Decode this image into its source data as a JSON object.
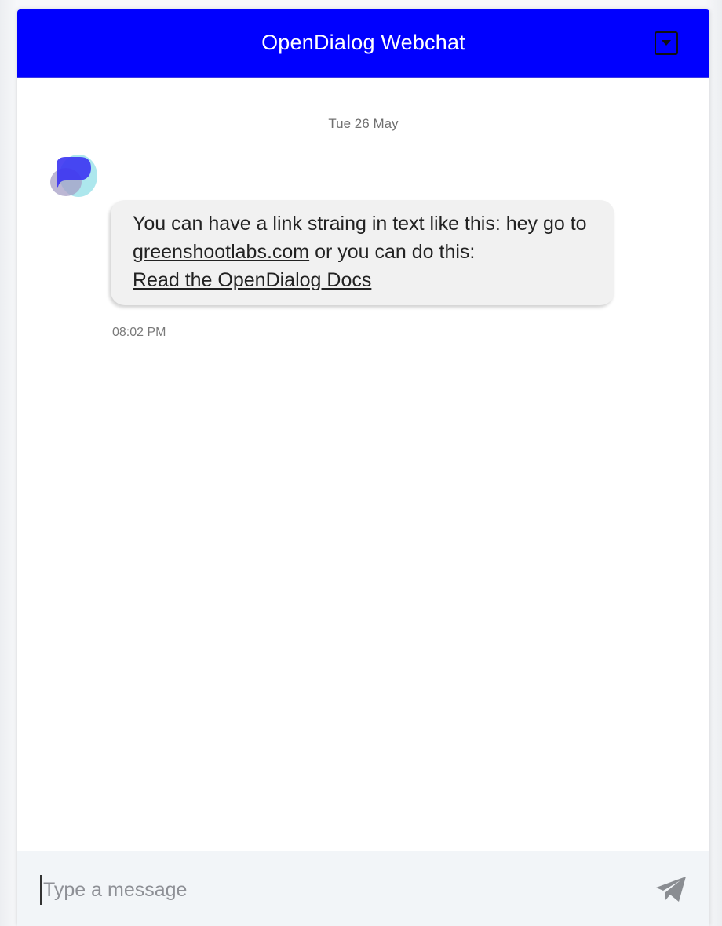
{
  "header": {
    "title": "OpenDialog Webchat",
    "toggle_icon": "caret-down-icon"
  },
  "conversation": {
    "date_separator": "Tue 26 May",
    "messages": [
      {
        "sender": "bot",
        "text_before_link": "You can have a link straing in text like this: hey go to ",
        "inline_link_text": "greenshootlabs.com",
        "text_after_link": " or you can do this: ",
        "button_link_text": "Read the OpenDialog Docs",
        "time": "08:02 PM"
      }
    ]
  },
  "composer": {
    "placeholder": "Type a message",
    "value": "",
    "send_icon": "paper-plane-icon"
  },
  "colors": {
    "header_bg": "#0000ff",
    "header_text": "#ffffff",
    "bubble_bg": "#f1f1f1",
    "composer_bg": "#f2f5f8",
    "send_icon": "#8a8d92"
  }
}
